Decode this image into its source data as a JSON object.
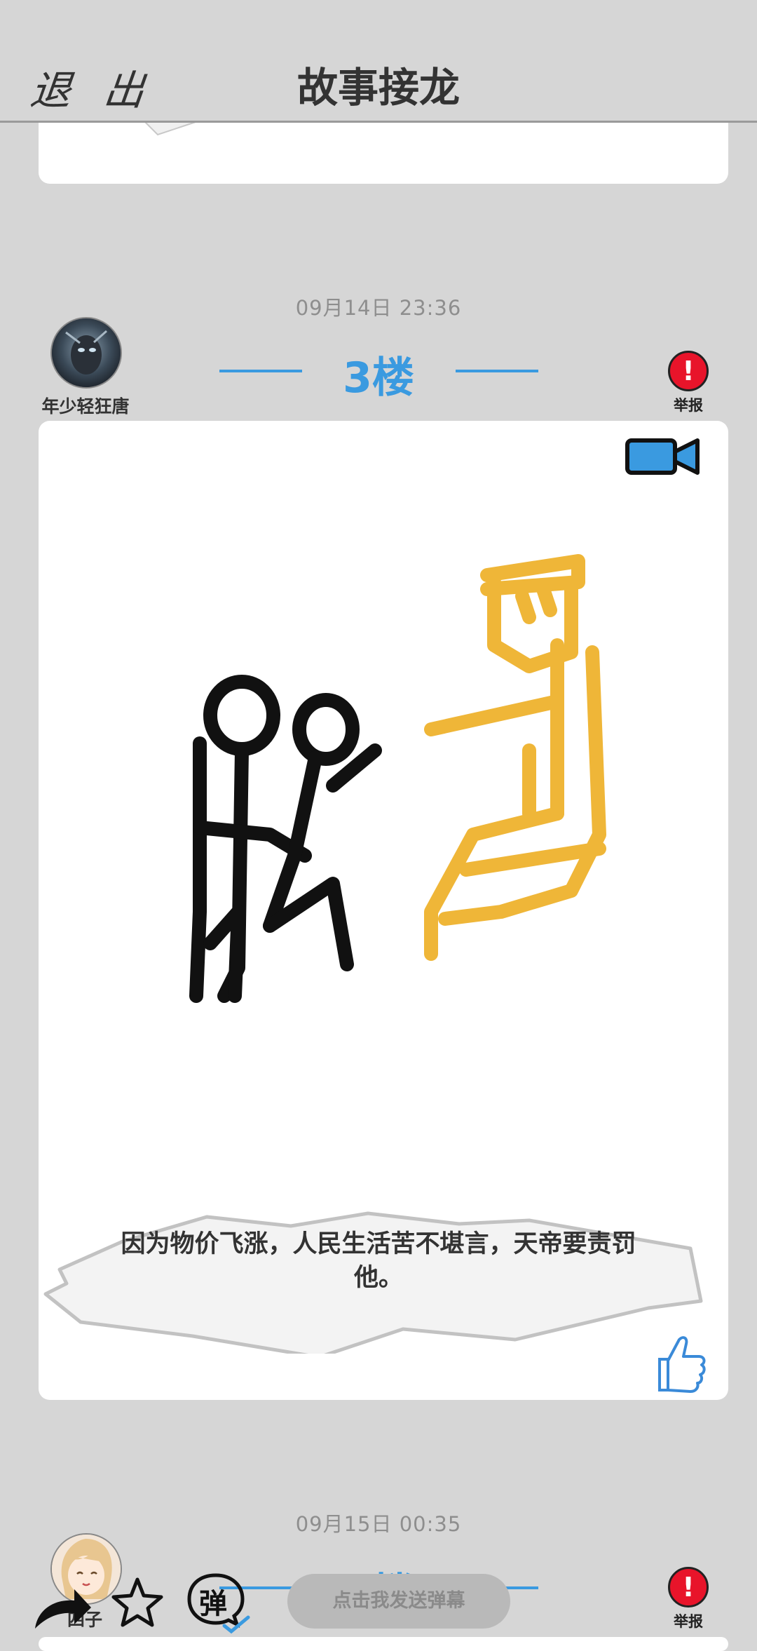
{
  "header": {
    "exit_label": "退 出",
    "title": "故事接龙"
  },
  "posts": [
    {
      "timestamp": "09月14日  23:36",
      "username": "年少轻狂唐",
      "floor": "3楼",
      "report_label": "举报",
      "caption": "因为物价飞涨，人民生活苦不堪言，天帝要责罚他。",
      "icons": [
        "video-camera-icon",
        "thumbs-up-icon"
      ]
    },
    {
      "timestamp": "09月15日  00:35",
      "username": "四子",
      "floor": "4楼",
      "report_label": "举报"
    }
  ],
  "bottom_bar": {
    "danmaku_placeholder": "点击我发送弹幕",
    "danmaku_glyph": "弹",
    "icons": [
      "share-arrow-icon",
      "star-icon",
      "danmaku-toggle-icon"
    ]
  },
  "colors": {
    "accent": "#3a9ae0",
    "report": "#e8142a",
    "background": "#d6d6d6",
    "drawing_yellow": "#efb638"
  }
}
